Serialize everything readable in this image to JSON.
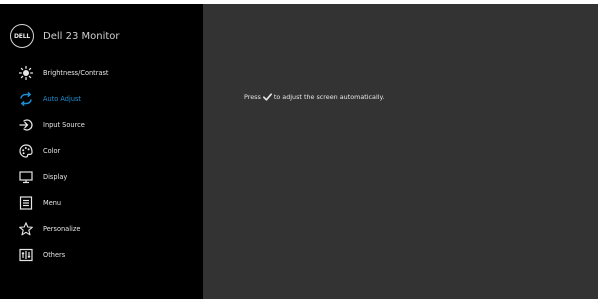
{
  "header": {
    "logo_text": "DELL",
    "title": "Dell 23 Monitor"
  },
  "menu": {
    "items": [
      {
        "label": "Brightness/Contrast",
        "icon": "brightness-icon"
      },
      {
        "label": "Auto Adjust",
        "icon": "auto-adjust-icon",
        "active": true
      },
      {
        "label": "Input Source",
        "icon": "input-source-icon"
      },
      {
        "label": "Color",
        "icon": "color-palette-icon"
      },
      {
        "label": "Display",
        "icon": "display-icon"
      },
      {
        "label": "Menu",
        "icon": "menu-icon"
      },
      {
        "label": "Personalize",
        "icon": "star-icon"
      },
      {
        "label": "Others",
        "icon": "others-icon"
      }
    ]
  },
  "content": {
    "message_before": "Press",
    "message_icon": "checkmark-icon",
    "message_after": "to adjust the screen automatically."
  },
  "colors": {
    "sidebar_bg": "#000000",
    "content_bg": "#333333",
    "accent": "#1d8fd1",
    "text": "#e6e6e6"
  }
}
